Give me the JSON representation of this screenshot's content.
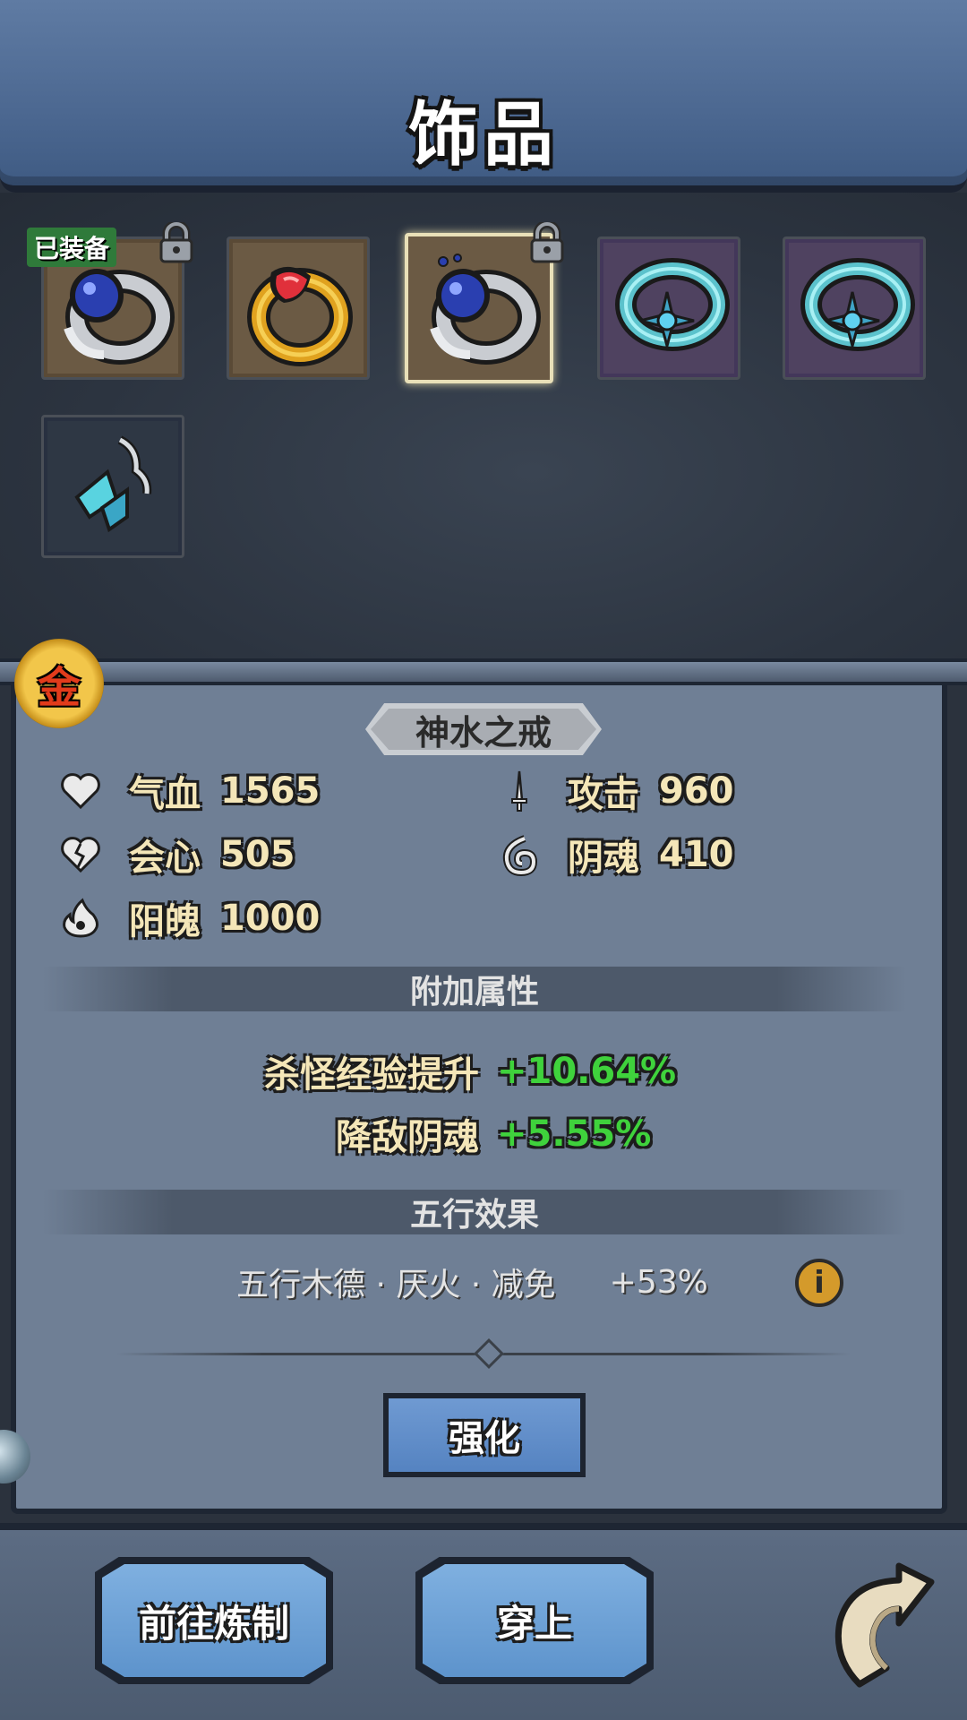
{
  "header": {
    "title": "饰品"
  },
  "inventory": {
    "equipped_tag": "已装备",
    "slots": [
      {
        "item": "dark-pearl-ring",
        "frame": "brown",
        "locked": true,
        "equipped": true
      },
      {
        "item": "gold-ruby-ring",
        "frame": "brown",
        "locked": false
      },
      {
        "item": "dark-pearl-ring",
        "frame": "brown",
        "locked": true,
        "selected": true
      },
      {
        "item": "ice-crystal-ring",
        "frame": "purple",
        "locked": false
      },
      {
        "item": "ice-crystal-ring",
        "frame": "purple",
        "locked": false
      },
      {
        "item": "crystal-pendant",
        "frame": "dark",
        "locked": false
      }
    ]
  },
  "detail": {
    "element_badge": "金",
    "item_name": "神水之戒",
    "stats": [
      {
        "icon": "heart-icon",
        "label": "气血",
        "value": "1565"
      },
      {
        "icon": "sword-icon",
        "label": "攻击",
        "value": "960"
      },
      {
        "icon": "broken-heart-icon",
        "label": "会心",
        "value": "505"
      },
      {
        "icon": "swirl-icon",
        "label": "阴魂",
        "value": "410"
      },
      {
        "icon": "flame-icon",
        "label": "阳魄",
        "value": "1000"
      }
    ],
    "extra_title": "附加属性",
    "extra_attrs": [
      {
        "label": "杀怪经验提升",
        "value": "+10.64%"
      },
      {
        "label": "降敌阴魂",
        "value": "+5.55%"
      }
    ],
    "wuxing_title": "五行效果",
    "wuxing_effect": {
      "label": "五行木德 · 厌火 · 减免",
      "value": "+53%"
    },
    "enhance_button": "强化"
  },
  "footer": {
    "refine_button": "前往炼制",
    "wear_button": "穿上"
  },
  "colors": {
    "header_blue": "#4c6891",
    "panel_grey": "#6f7f95",
    "stat_text": "#f4e6b8",
    "bonus_green": "#3fd23c",
    "button_blue": "#5d93cc"
  }
}
